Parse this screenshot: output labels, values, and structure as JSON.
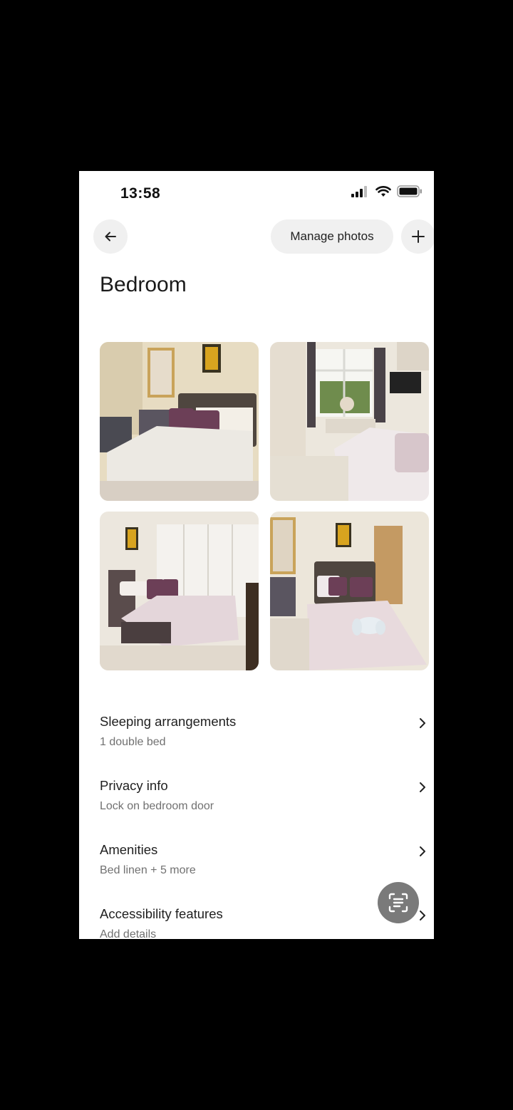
{
  "status_bar": {
    "time": "13:58",
    "icons": [
      "signal-icon",
      "wifi-icon",
      "battery-icon"
    ]
  },
  "header": {
    "back_icon": "arrow-left-icon",
    "manage_label": "Manage photos",
    "add_icon": "plus-icon"
  },
  "page": {
    "title": "Bedroom"
  },
  "photos": [
    {
      "name": "bedroom-photo-1"
    },
    {
      "name": "bedroom-photo-2"
    },
    {
      "name": "bedroom-photo-3"
    },
    {
      "name": "bedroom-photo-4"
    }
  ],
  "sections": [
    {
      "title": "Sleeping arrangements",
      "subtitle": "1 double bed"
    },
    {
      "title": "Privacy info",
      "subtitle": "Lock on bedroom door"
    },
    {
      "title": "Amenities",
      "subtitle": "Bed linen + 5 more"
    },
    {
      "title": "Accessibility features",
      "subtitle": "Add details"
    }
  ],
  "floating": {
    "icon": "text-scan-icon"
  }
}
